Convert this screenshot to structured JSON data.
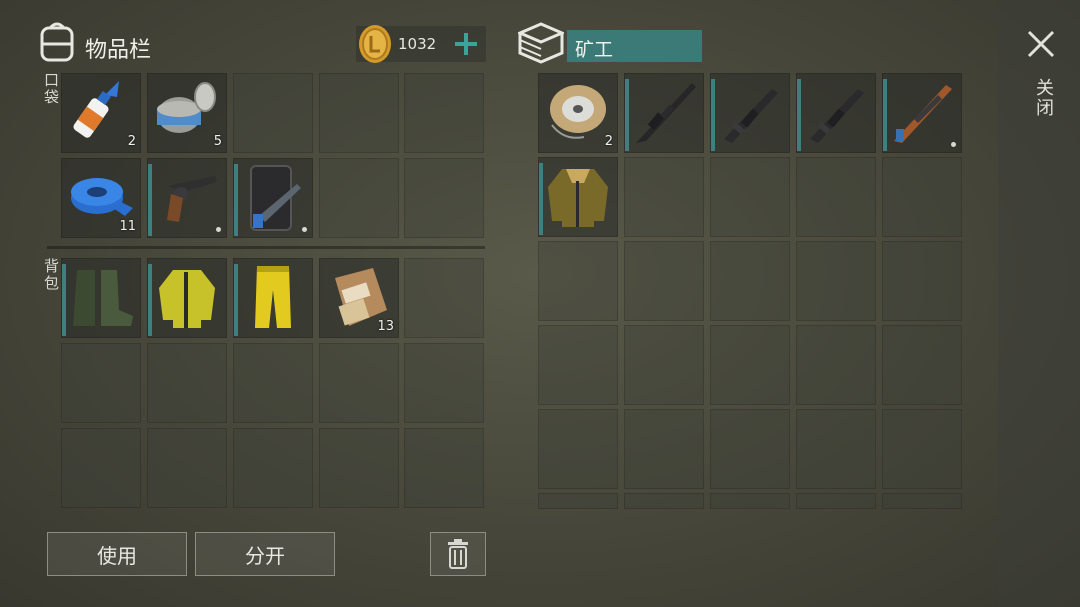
{
  "inventory": {
    "title": "物品栏",
    "coins": "1032",
    "add_icon": "plus-icon",
    "pocket_label": "口袋",
    "backpack_label": "背包",
    "pocket_items": [
      {
        "name": "glue",
        "qty": "2"
      },
      {
        "name": "canned-food",
        "qty": "5"
      },
      {
        "name": "empty"
      },
      {
        "name": "empty"
      },
      {
        "name": "empty"
      },
      {
        "name": "duct-tape",
        "qty": "11"
      },
      {
        "name": "revolver",
        "qty": ""
      },
      {
        "name": "police-shield-shotgun",
        "qty": ""
      },
      {
        "name": "empty"
      },
      {
        "name": "empty"
      }
    ],
    "backpack_items": [
      {
        "name": "rubber-boots",
        "qty": ""
      },
      {
        "name": "yellow-jacket",
        "qty": ""
      },
      {
        "name": "yellow-pants",
        "qty": ""
      },
      {
        "name": "mre",
        "qty": "13"
      }
    ]
  },
  "container": {
    "name": "矿工",
    "items": [
      {
        "name": "wire-spool",
        "qty": "2"
      },
      {
        "name": "assault-rifle",
        "qty": ""
      },
      {
        "name": "smg",
        "qty": ""
      },
      {
        "name": "smg",
        "qty": ""
      },
      {
        "name": "hunting-rifle",
        "qty": ""
      },
      {
        "name": "bomber-jacket",
        "qty": ""
      }
    ]
  },
  "actions": {
    "use": "使用",
    "split": "分开",
    "delete_icon": "trash-icon"
  },
  "close_label": "关闭",
  "colors": {
    "accent": "#3f7f80",
    "container_name_bg": "#3c7a78"
  }
}
